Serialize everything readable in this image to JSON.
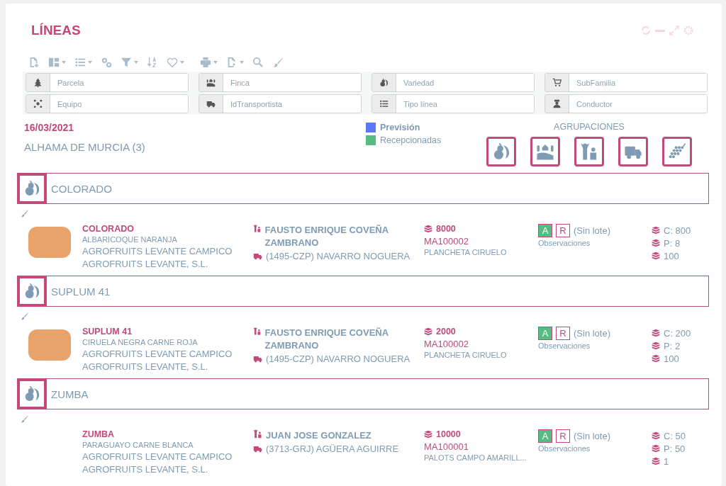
{
  "title": "LÍNEAS",
  "toolbar": [
    {
      "kind": "new",
      "dropdown": false
    },
    {
      "kind": "layout",
      "dropdown": true
    },
    {
      "kind": "list",
      "dropdown": true
    },
    {
      "kind": "gears",
      "dropdown": false
    },
    {
      "kind": "filter",
      "dropdown": true
    },
    {
      "kind": "sort",
      "dropdown": false
    },
    {
      "kind": "heart",
      "dropdown": true
    },
    {
      "kind": "print",
      "dropdown": true
    },
    {
      "kind": "export",
      "dropdown": true
    },
    {
      "kind": "search",
      "dropdown": false
    },
    {
      "kind": "brush",
      "dropdown": false
    }
  ],
  "filters": [
    {
      "kind": "tree",
      "placeholder": "Parcela"
    },
    {
      "kind": "farm",
      "placeholder": "Finca"
    },
    {
      "kind": "fruit",
      "placeholder": "Variedad"
    },
    {
      "kind": "cart",
      "placeholder": "SubFamilia"
    },
    {
      "kind": "team",
      "placeholder": "Equipo"
    },
    {
      "kind": "truck",
      "placeholder": "IdTransportista"
    },
    {
      "kind": "list",
      "placeholder": "Tipo línea"
    },
    {
      "kind": "driver",
      "placeholder": "Conductor"
    }
  ],
  "date": "16/03/2021",
  "location": "ALHAMA DE MURCIA (3)",
  "legend": [
    {
      "label": "Previsión",
      "color": "#5b78f6",
      "bold": true
    },
    {
      "label": "Recepcionadas",
      "color": "#55bd82",
      "bold": false
    }
  ],
  "groupings_label": "AGRUPACIONES",
  "groupings": [
    {
      "kind": "fruit"
    },
    {
      "kind": "farm"
    },
    {
      "kind": "people"
    },
    {
      "kind": "truck"
    },
    {
      "kind": "grapes"
    }
  ],
  "groups": [
    {
      "name": "COLORADO",
      "item": {
        "photo": true,
        "variety": "COLORADO",
        "product": "ALBARICOQUE NARANJA",
        "company": "AGROFRUITS LEVANTE CAMPICO",
        "company_legal": "AGROFRUITS LEVANTE, S.L.",
        "supplier": "FAUSTO ENRIQUE COVEÑA ZAMBRANO",
        "transport": "(1495-CZP) NAVARRO NOGUERA",
        "quantity": "8000",
        "code": "MA100002",
        "container": "PLANCHETA CIRUELO",
        "status_buttons": [
          {
            "label": "A",
            "selected": true
          },
          {
            "label": "R",
            "selected": false
          }
        ],
        "lot": "(Sin lote)",
        "notes": "Observaciones",
        "counts": [
          "C: 800",
          "P: 8",
          "100"
        ]
      }
    },
    {
      "name": "SUPLUM 41",
      "item": {
        "photo": true,
        "variety": "SUPLUM 41",
        "product": "CIRUELA NEGRA CARNE ROJA",
        "company": "AGROFRUITS LEVANTE CAMPICO",
        "company_legal": "AGROFRUITS LEVANTE, S.L.",
        "supplier": "FAUSTO ENRIQUE COVEÑA ZAMBRANO",
        "transport": "(1495-CZP) NAVARRO NOGUERA",
        "quantity": "2000",
        "code": "MA100002",
        "container": "PLANCHETA CIRUELO",
        "status_buttons": [
          {
            "label": "A",
            "selected": true
          },
          {
            "label": "R",
            "selected": false
          }
        ],
        "lot": "(Sin lote)",
        "notes": "Observaciones",
        "counts": [
          "C: 200",
          "P: 2",
          "100"
        ]
      }
    },
    {
      "name": "ZUMBA",
      "item": {
        "photo": false,
        "variety": "ZUMBA",
        "product": "PARAGUAYO CARNE BLANCA",
        "company": "AGROFRUITS LEVANTE CAMPICO",
        "company_legal": "AGROFRUITS LEVANTE, S.L.",
        "supplier": "JUAN JOSE GONZALEZ",
        "transport": "(3713-GRJ) AGÜERA AGUIRRE",
        "quantity": "10000",
        "code": "MA100001",
        "container": "PALOTS CAMPO AMARILL...",
        "status_buttons": [
          {
            "label": "A",
            "selected": true
          },
          {
            "label": "R",
            "selected": false
          }
        ],
        "lot": "(Sin lote)",
        "notes": "Observaciones",
        "counts": [
          "C: 50",
          "P: 50",
          "1"
        ]
      }
    }
  ]
}
